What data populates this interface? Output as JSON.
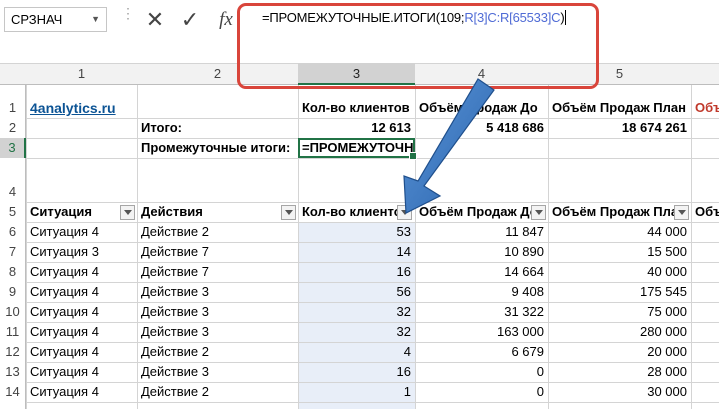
{
  "formula_bar": {
    "name_box": "СРЗНАЧ",
    "cancel_icon": "✕",
    "enter_icon": "✓",
    "fx_label": "fx",
    "formula_prefix": "=ПРОМЕЖУТОЧНЫЕ.ИТОГИ(109;",
    "formula_ref": "R[3]C:R[65533]C",
    "formula_suffix": ")"
  },
  "column_headers": [
    "1",
    "2",
    "3",
    "4",
    "5"
  ],
  "row_headers": [
    "1",
    "2",
    "3",
    "4",
    "5",
    "6",
    "7",
    "8",
    "9",
    "10",
    "11",
    "12",
    "13",
    "14"
  ],
  "header_rows": {
    "site_link": "4analytics.ru",
    "row1": [
      "Кол-во клиентов",
      "Объём Продаж До",
      "Объём Продаж План",
      "Объ"
    ],
    "totals_label": "Итого:",
    "totals": [
      "12 613",
      "5 418 686",
      "18 674 261"
    ],
    "subtotal_label": "Промежуточные итоги:",
    "subtotal_edit": "=ПРОМЕЖУТОЧН"
  },
  "table": {
    "headers": [
      "Ситуация",
      "Действия",
      "Кол-во клиенто",
      "Объём Продаж До",
      "Объём Продаж План",
      "Объ"
    ],
    "rows": [
      [
        "Ситуация 4",
        "Действие 2",
        "53",
        "11 847",
        "44 000"
      ],
      [
        "Ситуация 3",
        "Действие 7",
        "14",
        "10 890",
        "15 500"
      ],
      [
        "Ситуация 4",
        "Действие 7",
        "16",
        "14 664",
        "40 000"
      ],
      [
        "Ситуация 4",
        "Действие 3",
        "56",
        "9 408",
        "175 545"
      ],
      [
        "Ситуация 4",
        "Действие 3",
        "32",
        "31 322",
        "75 000"
      ],
      [
        "Ситуация 4",
        "Действие 3",
        "32",
        "163 000",
        "280 000"
      ],
      [
        "Ситуация 4",
        "Действие 2",
        "4",
        "6 679",
        "20 000"
      ],
      [
        "Ситуация 4",
        "Действие 3",
        "16",
        "0",
        "28 000"
      ],
      [
        "Ситуация 4",
        "Действие 2",
        "1",
        "0",
        "30 000"
      ]
    ]
  },
  "colors": {
    "accent_green": "#217346",
    "highlight_red": "#d9453b",
    "arrow_blue": "#3a78c2",
    "ref_blue": "#4f6bd5"
  }
}
